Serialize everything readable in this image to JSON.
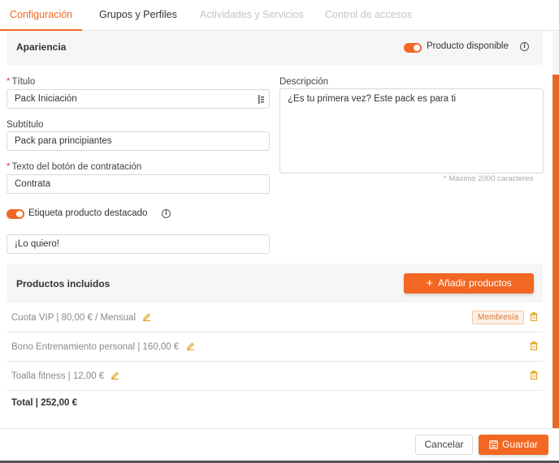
{
  "tabs": [
    {
      "label": "Configuración",
      "state": "active"
    },
    {
      "label": "Grupos y Perfiles",
      "state": "normal"
    },
    {
      "label": "Actividades y Servicios",
      "state": "disabled"
    },
    {
      "label": "Control de accesos",
      "state": "disabled"
    }
  ],
  "appearance": {
    "title": "Apariencia",
    "available_label": "Producto disponible",
    "available_on": true
  },
  "form": {
    "title_label": "Título",
    "title_value": "Pack Iniciación",
    "subtitle_label": "Subtítulo",
    "subtitle_value": "Pack para principiantes",
    "button_text_label": "Texto del botón de contratación",
    "button_text_value": "Contrata",
    "featured_label": "Etiqueta producto destacado",
    "featured_on": true,
    "featured_value": "¡Lo quiero!",
    "description_label": "Descripción",
    "description_value": "¿Es tu primera vez? Este pack es para ti",
    "description_hint": "* Máximo 2000 caracteres",
    "required_mark": "*"
  },
  "included": {
    "title": "Productos incluidos",
    "add_button": "Añadir productos",
    "items": [
      {
        "text": "Cuota VIP | 80,00 € /  Mensual",
        "badge": "Membresía"
      },
      {
        "text": "Bono Entrenamiento personal | 160,00 €",
        "badge": ""
      },
      {
        "text": "Toalla fitness | 12,00 €",
        "badge": ""
      }
    ],
    "total": "Total | 252,00 €"
  },
  "footer": {
    "cancel": "Cancelar",
    "save": "Guardar"
  },
  "colors": {
    "accent": "#f26722",
    "required": "#e03c31",
    "badge_bg": "#fdf0e6"
  }
}
